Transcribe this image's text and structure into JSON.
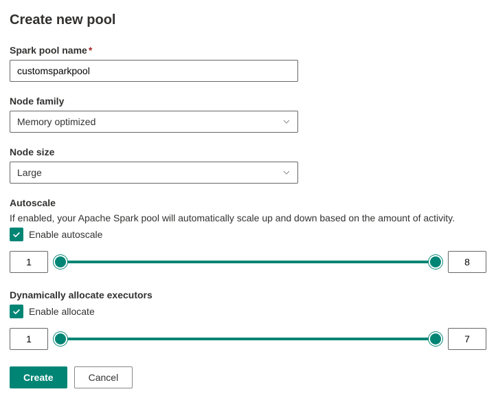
{
  "title": "Create new pool",
  "fields": {
    "poolName": {
      "label": "Spark pool name",
      "required": true,
      "value": "customsparkpool"
    },
    "nodeFamily": {
      "label": "Node family",
      "value": "Memory optimized"
    },
    "nodeSize": {
      "label": "Node size",
      "value": "Large"
    }
  },
  "autoscale": {
    "label": "Autoscale",
    "help": "If enabled, your Apache Spark pool will automatically scale up and down based on the amount of activity.",
    "checkboxLabel": "Enable autoscale",
    "min": "1",
    "max": "8"
  },
  "allocate": {
    "label": "Dynamically allocate executors",
    "checkboxLabel": "Enable allocate",
    "min": "1",
    "max": "7"
  },
  "buttons": {
    "create": "Create",
    "cancel": "Cancel"
  }
}
